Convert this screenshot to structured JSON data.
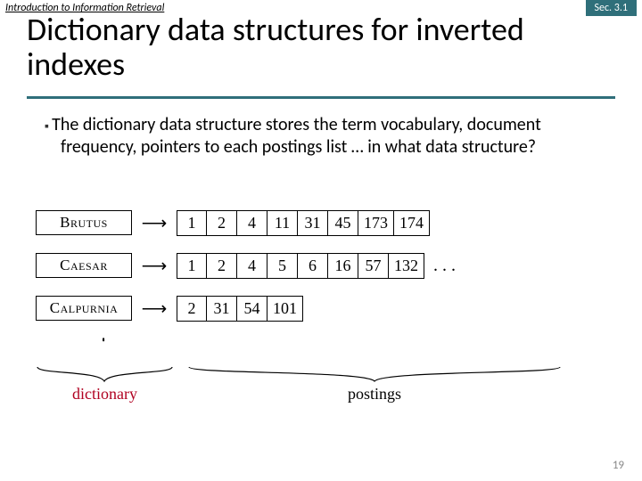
{
  "header": {
    "course": "Introduction to Information Retrieval",
    "section": "Sec. 3.1"
  },
  "title": "Dictionary data structures for inverted indexes",
  "bullet": "The dictionary data structure stores the term vocabulary, document frequency, pointers to each postings list … in what data structure?",
  "rows": [
    {
      "term": "Brutus",
      "postings": [
        "1",
        "2",
        "4",
        "11",
        "31",
        "45",
        "173",
        "174"
      ],
      "trail": ""
    },
    {
      "term": "Caesar",
      "postings": [
        "1",
        "2",
        "4",
        "5",
        "6",
        "16",
        "57",
        "132"
      ],
      "trail": ". . ."
    },
    {
      "term": "Calpurnia",
      "postings": [
        "2",
        "31",
        "54",
        "101"
      ],
      "trail": ""
    }
  ],
  "vdots": ". . .",
  "labels": {
    "dictionary": "dictionary",
    "postings": "postings"
  },
  "slidenum": "19"
}
